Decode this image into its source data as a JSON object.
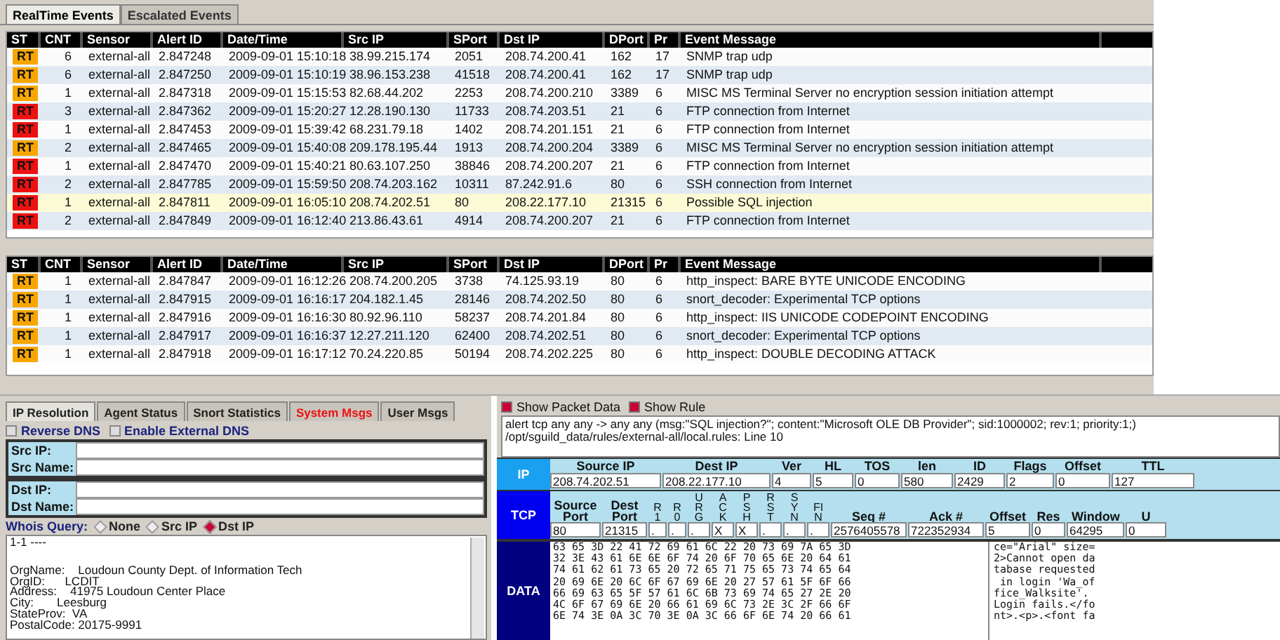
{
  "event_tabs": [
    {
      "label": "RealTime Events",
      "selected": true
    },
    {
      "label": "Escalated Events",
      "selected": false
    }
  ],
  "event_tables": [
    {
      "columns": [
        "ST",
        "CNT",
        "Sensor",
        "Alert ID",
        "Date/Time",
        "Src IP",
        "SPort",
        "Dst IP",
        "DPort",
        "Pr",
        "Event Message"
      ],
      "rows": [
        {
          "color": "#f7a600",
          "selected": false,
          "cells": [
            "RT",
            "6",
            "external-all",
            "2.847248",
            "2009-09-01 15:10:18",
            "38.99.215.174",
            "2051",
            "208.74.200.41",
            "162",
            "17",
            "SNMP trap udp"
          ]
        },
        {
          "color": "#f7a600",
          "selected": false,
          "cells": [
            "RT",
            "6",
            "external-all",
            "2.847250",
            "2009-09-01 15:10:19",
            "38.96.153.238",
            "41518",
            "208.74.200.41",
            "162",
            "17",
            "SNMP trap udp"
          ]
        },
        {
          "color": "#f7a600",
          "selected": false,
          "cells": [
            "RT",
            "1",
            "external-all",
            "2.847318",
            "2009-09-01 15:15:53",
            "82.68.44.202",
            "2253",
            "208.74.200.210",
            "3389",
            "6",
            "MISC MS Terminal Server no encryption session initiation attempt"
          ]
        },
        {
          "color": "#ee1111",
          "selected": false,
          "cells": [
            "RT",
            "3",
            "external-all",
            "2.847362",
            "2009-09-01 15:20:27",
            "12.28.190.130",
            "11733",
            "208.74.203.51",
            "21",
            "6",
            "FTP connection from Internet"
          ]
        },
        {
          "color": "#ee1111",
          "selected": false,
          "cells": [
            "RT",
            "1",
            "external-all",
            "2.847453",
            "2009-09-01 15:39:42",
            "68.231.79.18",
            "1402",
            "208.74.201.151",
            "21",
            "6",
            "FTP connection from Internet"
          ]
        },
        {
          "color": "#f7a600",
          "selected": false,
          "cells": [
            "RT",
            "2",
            "external-all",
            "2.847465",
            "2009-09-01 15:40:08",
            "209.178.195.44",
            "1913",
            "208.74.200.204",
            "3389",
            "6",
            "MISC MS Terminal Server no encryption session initiation attempt"
          ]
        },
        {
          "color": "#ee1111",
          "selected": false,
          "cells": [
            "RT",
            "1",
            "external-all",
            "2.847470",
            "2009-09-01 15:40:21",
            "80.63.107.250",
            "38846",
            "208.74.200.207",
            "21",
            "6",
            "FTP connection from Internet"
          ]
        },
        {
          "color": "#ee1111",
          "selected": false,
          "cells": [
            "RT",
            "2",
            "external-all",
            "2.847785",
            "2009-09-01 15:59:50",
            "208.74.203.162",
            "10311",
            "87.242.91.6",
            "80",
            "6",
            "SSH connection from Internet"
          ]
        },
        {
          "color": "#ee1111",
          "selected": true,
          "cells": [
            "RT",
            "1",
            "external-all",
            "2.847811",
            "2009-09-01 16:05:10",
            "208.74.202.51",
            "80",
            "208.22.177.10",
            "21315",
            "6",
            "Possible SQL injection"
          ]
        },
        {
          "color": "#ee1111",
          "selected": false,
          "cells": [
            "RT",
            "2",
            "external-all",
            "2.847849",
            "2009-09-01 16:12:40",
            "213.86.43.61",
            "4914",
            "208.74.200.207",
            "21",
            "6",
            "FTP connection from Internet"
          ]
        }
      ]
    },
    {
      "columns": [
        "ST",
        "CNT",
        "Sensor",
        "Alert ID",
        "Date/Time",
        "Src IP",
        "SPort",
        "Dst IP",
        "DPort",
        "Pr",
        "Event Message"
      ],
      "rows": [
        {
          "color": "#f7a600",
          "selected": false,
          "cells": [
            "RT",
            "1",
            "external-all",
            "2.847847",
            "2009-09-01 16:12:26",
            "208.74.200.205",
            "3738",
            "74.125.93.19",
            "80",
            "6",
            "http_inspect: BARE BYTE UNICODE ENCODING"
          ]
        },
        {
          "color": "#f7a600",
          "selected": false,
          "cells": [
            "RT",
            "1",
            "external-all",
            "2.847915",
            "2009-09-01 16:16:17",
            "204.182.1.45",
            "28146",
            "208.74.202.50",
            "80",
            "6",
            "snort_decoder: Experimental TCP options"
          ]
        },
        {
          "color": "#f7a600",
          "selected": false,
          "cells": [
            "RT",
            "1",
            "external-all",
            "2.847916",
            "2009-09-01 16:16:30",
            "80.92.96.110",
            "58237",
            "208.74.201.84",
            "80",
            "6",
            "http_inspect: IIS UNICODE CODEPOINT ENCODING"
          ]
        },
        {
          "color": "#f7a600",
          "selected": false,
          "cells": [
            "RT",
            "1",
            "external-all",
            "2.847917",
            "2009-09-01 16:16:37",
            "12.27.211.120",
            "62400",
            "208.74.202.51",
            "80",
            "6",
            "snort_decoder: Experimental TCP options"
          ]
        },
        {
          "color": "#f7a600",
          "selected": false,
          "cells": [
            "RT",
            "1",
            "external-all",
            "2.847918",
            "2009-09-01 16:17:12",
            "70.24.220.85",
            "50194",
            "208.74.202.225",
            "80",
            "6",
            "http_inspect: DOUBLE DECODING ATTACK"
          ]
        }
      ]
    }
  ],
  "resolution_tabs": [
    {
      "label": "IP Resolution",
      "selected": true,
      "alert": false
    },
    {
      "label": "Agent Status",
      "selected": false,
      "alert": false
    },
    {
      "label": "Snort Statistics",
      "selected": false,
      "alert": false
    },
    {
      "label": "System Msgs",
      "selected": false,
      "alert": true
    },
    {
      "label": "User Msgs",
      "selected": false,
      "alert": false
    }
  ],
  "dns_options": [
    {
      "label": "Reverse DNS",
      "checked": false
    },
    {
      "label": "Enable External DNS",
      "checked": false
    }
  ],
  "field_groups": [
    {
      "fields": [
        {
          "label": "Src IP:"
        },
        {
          "label": "Src Name:"
        }
      ]
    },
    {
      "fields": [
        {
          "label": "Dst IP:"
        },
        {
          "label": "Dst Name:"
        }
      ]
    }
  ],
  "whois": {
    "label": "Whois Query:",
    "options": [
      {
        "label": "None",
        "selected": false
      },
      {
        "label": "Src IP",
        "selected": false
      },
      {
        "label": "Dst IP",
        "selected": true
      }
    ],
    "lines": [
      "1-1 ----",
      "OrgName:    Loudoun County Dept. of Information Tech",
      "OrgID:      LCDIT",
      "Address:    41975 Loudoun Center Place",
      "City:       Leesburg",
      "StateProv:  VA",
      "PostalCode: 20175-9991"
    ]
  },
  "packet_options": [
    {
      "label": "Show Packet Data",
      "checked": true
    },
    {
      "label": "Show Rule",
      "checked": true
    }
  ],
  "rule_lines": [
    "alert tcp any any -> any any (msg:\"SQL injection?\"; content:\"Microsoft OLE DB Provider\"; sid:1000002; rev:1; priority:1;)",
    "/opt/sguild_data/rules/external-all/local.rules: Line 10"
  ],
  "ip_header": {
    "label": "IP",
    "fields": [
      {
        "label": "Source IP",
        "value": "208.74.202.51"
      },
      {
        "label": "Dest IP",
        "value": "208.22.177.10"
      },
      {
        "label": "Ver",
        "value": "4"
      },
      {
        "label": "HL",
        "value": "5"
      },
      {
        "label": "TOS",
        "value": "0"
      },
      {
        "label": "len",
        "value": "580"
      },
      {
        "label": "ID",
        "value": "2429"
      },
      {
        "label": "Flags",
        "value": "2"
      },
      {
        "label": "Offset",
        "value": "0"
      },
      {
        "label": "TTL",
        "value": "127"
      }
    ]
  },
  "tcp_header": {
    "label": "TCP",
    "fields": [
      {
        "kind": "text",
        "label": "Source Port",
        "value": "80"
      },
      {
        "kind": "text",
        "label": "Dest Port",
        "value": "21315"
      },
      {
        "kind": "flag",
        "label": "R1",
        "value": "."
      },
      {
        "kind": "flag",
        "label": "R0",
        "value": "."
      },
      {
        "kind": "flag",
        "label": "URG",
        "value": "."
      },
      {
        "kind": "flag",
        "label": "ACK",
        "value": "X"
      },
      {
        "kind": "flag",
        "label": "PSH",
        "value": "X"
      },
      {
        "kind": "flag",
        "label": "RST",
        "value": "."
      },
      {
        "kind": "flag",
        "label": "SYN",
        "value": "."
      },
      {
        "kind": "flag",
        "label": "FIN",
        "value": "."
      },
      {
        "kind": "text",
        "label": "Seq #",
        "value": "2576405578"
      },
      {
        "kind": "text",
        "label": "Ack #",
        "value": "722352934"
      },
      {
        "kind": "text",
        "label": "Offset",
        "value": "5"
      },
      {
        "kind": "text",
        "label": "Res",
        "value": "0"
      },
      {
        "kind": "text",
        "label": "Window",
        "value": "64295"
      },
      {
        "kind": "text",
        "label": "U",
        "value": "0"
      }
    ]
  },
  "data": {
    "label": "DATA",
    "hex_lines": [
      "63 65 3D 22 41 72 69 61 6C 22 20 73 69 7A 65 3D",
      "32 3E 43 61 6E 6E 6F 74 20 6F 70 65 6E 20 64 61",
      "74 61 62 61 73 65 20 72 65 71 75 65 73 74 65 64",
      "20 69 6E 20 6C 6F 67 69 6E 20 27 57 61 5F 6F 66",
      "66 69 63 65 5F 57 61 6C 6B 73 69 74 65 27 2E 20",
      "4C 6F 67 69 6E 20 66 61 69 6C 73 2E 3C 2F 66 6F",
      "6E 74 3E 0A 3C 70 3E 0A 3C 66 6F 6E 74 20 66 61"
    ],
    "ascii_lines": [
      "ce=\"Arial\" size=",
      "2>Cannot open da",
      "tabase requested",
      " in login 'Wa_of",
      "fice_Walksite'. ",
      "Login fails.</fo",
      "nt>.<p>.<font fa"
    ]
  }
}
